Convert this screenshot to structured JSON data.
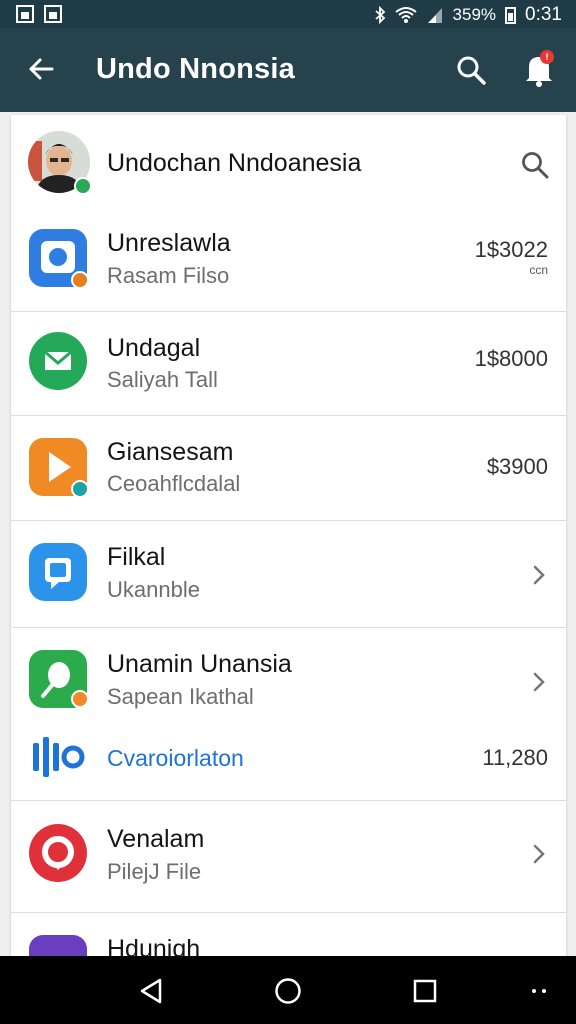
{
  "status_bar": {
    "battery": "359%",
    "time": "0:31"
  },
  "app_bar": {
    "title": "Undo Nnonsia"
  },
  "header_row": {
    "name": "Undochan Nndoanesia"
  },
  "items": [
    {
      "title": "Unreslawla",
      "subtitle": "Rasam Filso",
      "amount": "1$3022",
      "amount_sub": "ccn",
      "icon": "camera-icon",
      "color": "#2f7de1"
    },
    {
      "title": "Undagal",
      "subtitle": "Saliyah Tall",
      "amount": "1$8000",
      "icon": "message-icon",
      "color": "#23a957"
    },
    {
      "title": "Giansesam",
      "subtitle": "Ceoahflcdalal",
      "amount": "$3900",
      "icon": "play-icon",
      "color": "#f08a24"
    },
    {
      "title": "Filkal",
      "subtitle": "Ukannble",
      "icon": "chat-bubble-icon",
      "color": "#2b93ea"
    },
    {
      "title": "Unamin Unansia",
      "subtitle": "Sapean Ikathal",
      "icon": "leaf-icon",
      "color": "#2cab4d"
    },
    {
      "title": "Cvaroiorlaton",
      "amount": "11,280",
      "icon": "audio-bars-icon",
      "color": "#1e73d8"
    },
    {
      "title": "Venalam",
      "subtitle": "PilejJ File",
      "icon": "ring-icon",
      "color": "#e0313b"
    },
    {
      "title": "Hduniqh",
      "icon": "purple-app-icon",
      "color": "#6a3fbf"
    }
  ]
}
